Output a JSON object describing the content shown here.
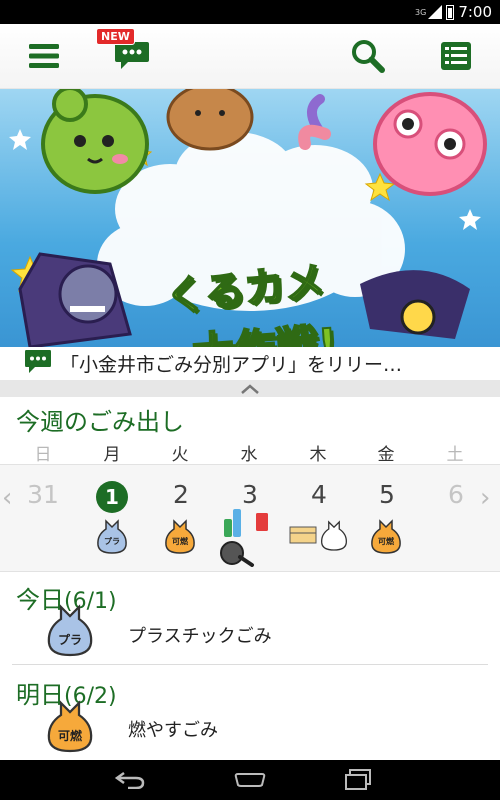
{
  "statusbar": {
    "network": "3G",
    "time": "7:00"
  },
  "toolbar": {
    "new_badge": "NEW",
    "icons": [
      "menu-icon",
      "chat-icon",
      "search-icon",
      "list-icon"
    ]
  },
  "banner": {
    "title_line1": "くるカメ",
    "title_line2": "大作戦!"
  },
  "news": {
    "text": "「小金井市ごみ分別アプリ」をリリー…"
  },
  "week": {
    "title": "今週のごみ出し",
    "weekdays": [
      "日",
      "月",
      "火",
      "水",
      "木",
      "金",
      "土"
    ],
    "days": [
      "31",
      "1",
      "2",
      "3",
      "4",
      "5",
      "6"
    ],
    "today_index": 1,
    "arrows": {
      "prev": "‹",
      "next": "›"
    }
  },
  "bag_labels": {
    "plastic": "プラ",
    "burnable": "可燃"
  },
  "colors": {
    "accent": "#1d6d25",
    "plastic_bag": "#a9c3e6",
    "burnable_bag": "#f6a93b"
  },
  "today": {
    "label": "今日",
    "date": "(6/1)",
    "item": "プラスチックごみ"
  },
  "tomorrow": {
    "label": "明日",
    "date": "(6/2)",
    "item": "燃やすごみ"
  }
}
